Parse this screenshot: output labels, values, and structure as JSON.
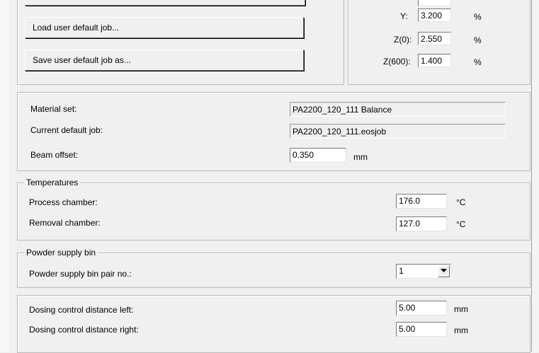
{
  "buttons": {
    "load_default_job": "Load user default job...",
    "save_default_job_as": "Save user default job as..."
  },
  "scaling": {
    "y": {
      "label": "Y:",
      "value": "3.200",
      "unit": "%"
    },
    "z0": {
      "label": "Z(0):",
      "value": "2.550",
      "unit": "%"
    },
    "z600": {
      "label": "Z(600):",
      "value": "1.400",
      "unit": "%"
    }
  },
  "job_info": {
    "material_set_label": "Material set:",
    "material_set_value": "PA2200_120_111 Balance",
    "current_default_job_label": "Current default job:",
    "current_default_job_value": "PA2200_120_111.eosjob",
    "beam_offset_label": "Beam offset:",
    "beam_offset_value": "0.350",
    "beam_offset_unit": "mm"
  },
  "temperatures": {
    "title": "Temperatures",
    "process_chamber_label": "Process chamber:",
    "process_chamber_value": "176.0",
    "process_chamber_unit": "°C",
    "removal_chamber_label": "Removal chamber:",
    "removal_chamber_value": "127.0",
    "removal_chamber_unit": "°C"
  },
  "powder_supply": {
    "title": "Powder supply bin",
    "pair_no_label": "Powder supply bin pair no.:",
    "pair_no_value": "1"
  },
  "dosing": {
    "left_label": "Dosing control distance left:",
    "left_value": "5.00",
    "left_unit": "mm",
    "right_label": "Dosing control distance right:",
    "right_value": "5.00",
    "right_unit": "mm"
  }
}
